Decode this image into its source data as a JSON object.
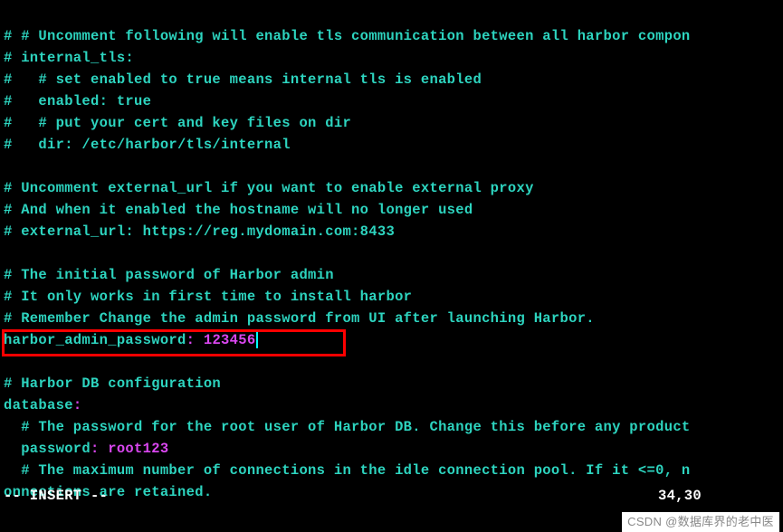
{
  "lines": {
    "l1": "# # Uncomment following will enable tls communication between all harbor compon",
    "l2": "# internal_tls:",
    "l3": "#   # set enabled to true means internal tls is enabled",
    "l4": "#   enabled: true",
    "l5": "#   # put your cert and key files on dir",
    "l6": "#   dir: /etc/harbor/tls/internal",
    "l7": "",
    "l8": "# Uncomment external_url if you want to enable external proxy",
    "l9": "# And when it enabled the hostname will no longer used",
    "l10": "# external_url: https://reg.mydomain.com:8433",
    "l11": "",
    "l12": "# The initial password of Harbor admin",
    "l13": "# It only works in first time to install harbor",
    "l14": "# Remember Change the admin password from UI after launching Harbor.",
    "l15_key": "harbor_admin_password",
    "l15_colon": ":",
    "l15_value": " 123456",
    "l16": "",
    "l17": "# Harbor DB configuration",
    "l18_key": "database",
    "l18_colon": ":",
    "l19": "  # The password for the root user of Harbor DB. Change this before any product",
    "l20_key": "  password",
    "l20_colon": ":",
    "l20_value": " root123",
    "l21": "  # The maximum number of connections in the idle connection pool. If it <=0, n",
    "l22": "onnections are retained."
  },
  "status": {
    "mode": "-- INSERT --",
    "position": "34,30"
  },
  "watermark": "CSDN @数据库界的老中医"
}
